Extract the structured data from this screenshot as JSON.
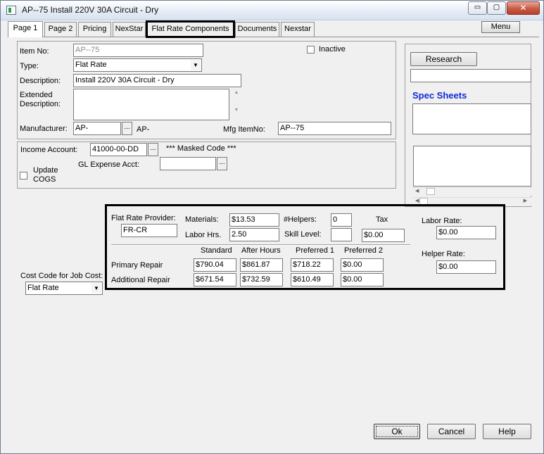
{
  "window": {
    "title": "AP--75  Install 220V 30A Circuit - Dry",
    "close_glyph": "✕",
    "min_glyph": "▭",
    "max_glyph": "▢"
  },
  "tabs": [
    {
      "label": "Page 1"
    },
    {
      "label": "Page 2"
    },
    {
      "label": "Pricing"
    },
    {
      "label": "NexStar"
    },
    {
      "label": "Flat Rate Components"
    },
    {
      "label": "Documents"
    },
    {
      "label": "Nexstar"
    }
  ],
  "menu_label": "Menu",
  "item": {
    "item_no_label": "Item No:",
    "item_no_value": "AP--75",
    "inactive_label": "Inactive",
    "type_label": "Type:",
    "type_value": "Flat Rate",
    "description_label": "Description:",
    "description_value": "Install 220V 30A Circuit - Dry",
    "ext_desc_label_1": "Extended",
    "ext_desc_label_2": "Description:",
    "ext_desc_value": "",
    "manufacturer_label": "Manufacturer:",
    "manufacturer_value": "AP-",
    "manufacturer_text": "AP-",
    "mfg_itemno_label": "Mfg ItemNo:",
    "mfg_itemno_value": "AP--75",
    "ellipsis": "..."
  },
  "accounts": {
    "income_label": "Income Account:",
    "income_value": "41000-00-DD",
    "masked_code": "*** Masked Code ***",
    "gl_label": "GL Expense Acct:",
    "gl_value": "",
    "update_cogs_1": "Update",
    "update_cogs_2": "COGS"
  },
  "right_panel": {
    "research_label": "Research",
    "spec_sheets_title": "Spec Sheets"
  },
  "flat_rate": {
    "provider_label": "Flat Rate Provider:",
    "provider_value": "FR-CR",
    "materials_label": "Materials:",
    "materials_value": "$13.53",
    "helpers_label": "#Helpers:",
    "helpers_value": "0",
    "tax_label": "Tax",
    "tax_value": "$0.00",
    "labor_hrs_label": "Labor Hrs.",
    "labor_hrs_value": "2.50",
    "skill_level_label": "Skill Level:",
    "skill_level_value": "",
    "labor_rate_label": "Labor Rate:",
    "labor_rate_value": "$0.00",
    "helper_rate_label": "Helper Rate:",
    "helper_rate_value": "$0.00",
    "columns": [
      "Standard",
      "After Hours",
      "Preferred 1",
      "Preferred 2"
    ],
    "rows": [
      {
        "label": "Primary Repair",
        "values": [
          "$790.04",
          "$861.87",
          "$718.22",
          "$0.00"
        ]
      },
      {
        "label": "Additional Repair",
        "values": [
          "$671.54",
          "$732.59",
          "$610.49",
          "$0.00"
        ]
      }
    ]
  },
  "cost_code": {
    "label": "Cost Code for Job Cost:",
    "value": "Flat Rate"
  },
  "buttons": {
    "ok": "Ok",
    "cancel": "Cancel",
    "help": "Help"
  },
  "icons": {
    "dropdown": "▼",
    "scroll_up": "▲",
    "scroll_down": "▼",
    "scroll_left": "◀",
    "scroll_right": "▶"
  }
}
